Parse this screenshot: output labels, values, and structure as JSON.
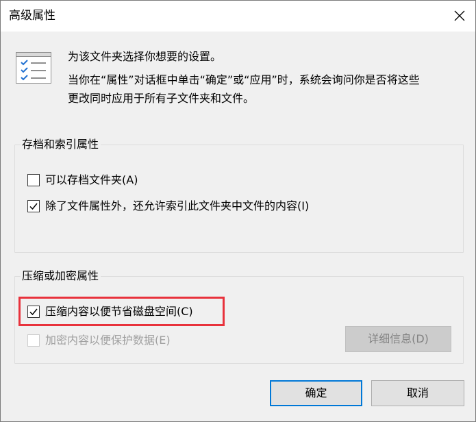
{
  "window": {
    "title": "高级属性",
    "close_icon": "close-icon"
  },
  "header": {
    "icon": "attributes-list-icon",
    "line1": "为该文件夹选择你想要的设置。",
    "line2": "当你在“属性”对话框中单击“确定”或“应用”时，系统会询问你是否将这些",
    "line3": "更改同时应用于所有子文件夹和文件。"
  },
  "archive_group": {
    "title": "存档和索引属性",
    "archive": {
      "label": "可以存档文件夹(A)",
      "checked": false,
      "enabled": true
    },
    "index": {
      "label": "除了文件属性外，还允许索引此文件夹中文件的内容(I)",
      "checked": true,
      "enabled": true
    }
  },
  "compress_group": {
    "title": "压缩或加密属性",
    "compress": {
      "label": "压缩内容以便节省磁盘空间(C)",
      "checked": true,
      "enabled": true,
      "highlighted": true
    },
    "encrypt": {
      "label": "加密内容以便保护数据(E)",
      "checked": false,
      "enabled": false
    },
    "details_button": {
      "label": "详细信息(D)",
      "enabled": false
    }
  },
  "footer": {
    "ok_label": "确定",
    "cancel_label": "取消"
  },
  "colors": {
    "highlight_box": "#e8323c",
    "primary_button_border": "#0078d7",
    "dialog_background": "#f0f0f0"
  }
}
